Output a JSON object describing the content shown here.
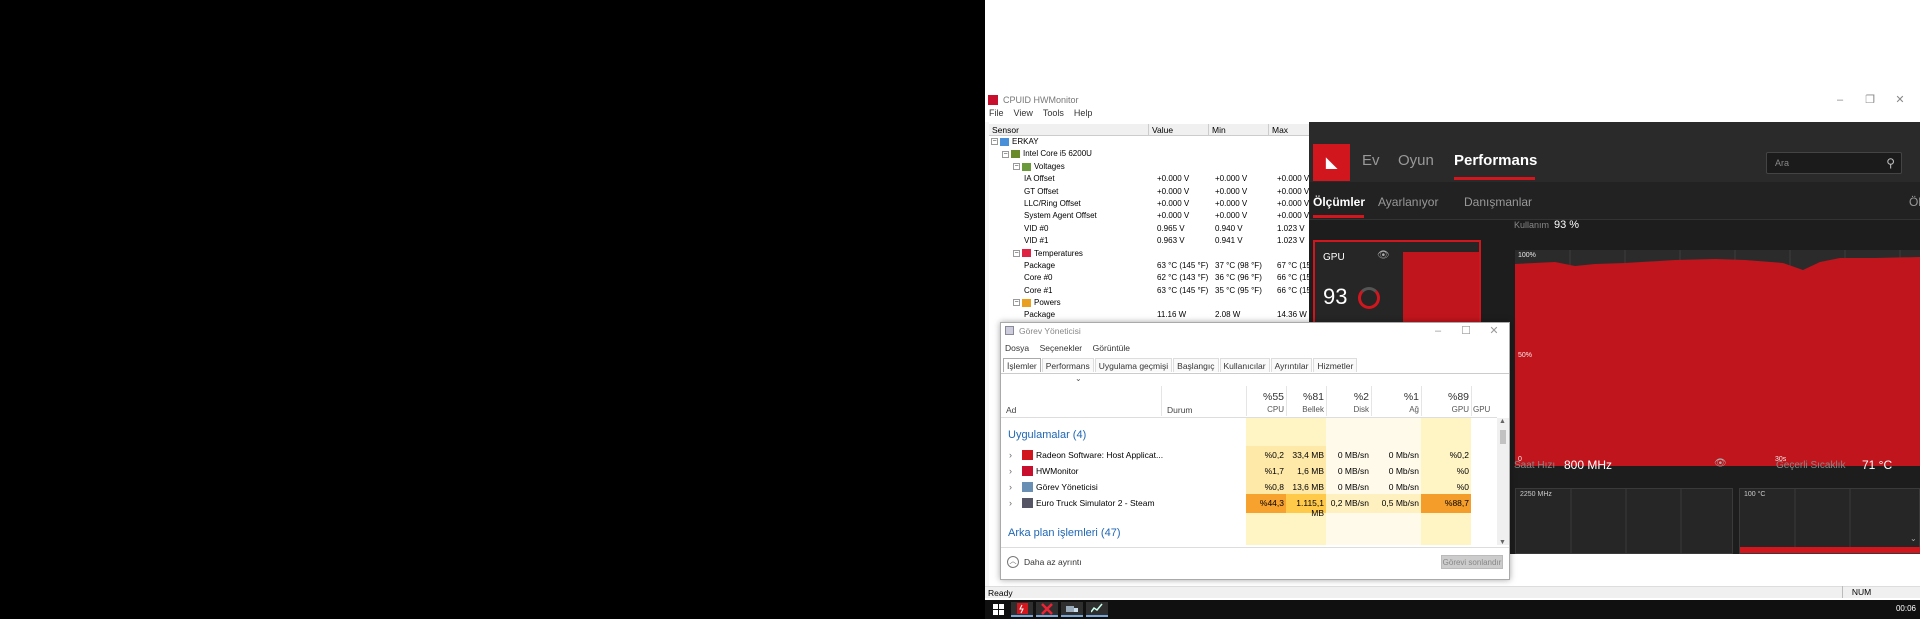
{
  "hwmonitor": {
    "title": "CPUID HWMonitor",
    "menu": [
      "File",
      "View",
      "Tools",
      "Help"
    ],
    "columns": [
      "Sensor",
      "Value",
      "Min",
      "Max"
    ],
    "rows": [
      {
        "name": "ERKAY",
        "indent": 0,
        "type": "computer",
        "value": "",
        "min": "",
        "max": ""
      },
      {
        "name": "Intel Core i5 6200U",
        "indent": 1,
        "type": "cpu",
        "value": "",
        "min": "",
        "max": ""
      },
      {
        "name": "Voltages",
        "indent": 2,
        "type": "voltages",
        "value": "",
        "min": "",
        "max": ""
      },
      {
        "name": "IA Offset",
        "indent": 3,
        "type": "leaf",
        "value": "+0.000 V",
        "min": "+0.000 V",
        "max": "+0.000 V"
      },
      {
        "name": "GT Offset",
        "indent": 3,
        "type": "leaf",
        "value": "+0.000 V",
        "min": "+0.000 V",
        "max": "+0.000 V"
      },
      {
        "name": "LLC/Ring Offset",
        "indent": 3,
        "type": "leaf",
        "value": "+0.000 V",
        "min": "+0.000 V",
        "max": "+0.000 V"
      },
      {
        "name": "System Agent Offset",
        "indent": 3,
        "type": "leaf",
        "value": "+0.000 V",
        "min": "+0.000 V",
        "max": "+0.000 V"
      },
      {
        "name": "VID #0",
        "indent": 3,
        "type": "leaf",
        "value": "0.965 V",
        "min": "0.940 V",
        "max": "1.023 V"
      },
      {
        "name": "VID #1",
        "indent": 3,
        "type": "leaf",
        "value": "0.963 V",
        "min": "0.941 V",
        "max": "1.023 V"
      },
      {
        "name": "Temperatures",
        "indent": 2,
        "type": "temps",
        "value": "",
        "min": "",
        "max": ""
      },
      {
        "name": "Package",
        "indent": 3,
        "type": "leaf",
        "value": "63 °C  (145 °F)",
        "min": "37 °C  (98 °F)",
        "max": "67 °C  (15"
      },
      {
        "name": "Core #0",
        "indent": 3,
        "type": "leaf",
        "value": "62 °C  (143 °F)",
        "min": "36 °C  (96 °F)",
        "max": "66 °C  (15"
      },
      {
        "name": "Core #1",
        "indent": 3,
        "type": "leaf",
        "value": "63 °C  (145 °F)",
        "min": "35 °C  (95 °F)",
        "max": "66 °C  (15"
      },
      {
        "name": "Powers",
        "indent": 2,
        "type": "powers",
        "value": "",
        "min": "",
        "max": ""
      },
      {
        "name": "Package",
        "indent": 3,
        "type": "leaf",
        "value": "11.16 W",
        "min": "2.08 W",
        "max": "14.36 W"
      }
    ],
    "status": "Ready",
    "num": "NUM"
  },
  "amd": {
    "nav": [
      "Ev",
      "Oyun",
      "Performans"
    ],
    "search_placeholder": "Ara",
    "subtabs": [
      "Ölçümler",
      "Ayarlanıyor",
      "Danışmanlar",
      "Ölç"
    ],
    "gpu_label": "GPU",
    "gpu_value": "93",
    "usage_label": "Kullanım",
    "usage_value": "93 %",
    "chart_labels": {
      "top": "100%",
      "mid": "50%",
      "x0": "0",
      "x1": "30s"
    },
    "clock_label": "Saat Hızı",
    "clock_value": "800 MHz",
    "temp_label": "Geçerli Sıcaklık",
    "temp_value": "71 °C",
    "mini_left_label": "2250 MHz",
    "mini_right_label": "100 °C",
    "colors": {
      "accent": "#d2161e",
      "bg": "#1d1d1d"
    }
  },
  "taskmgr": {
    "title": "Görev Yöneticisi",
    "menu": [
      "Dosya",
      "Seçenekler",
      "Görüntüle"
    ],
    "tabs": [
      "İşlemler",
      "Performans",
      "Uygulama geçmişi",
      "Başlangıç",
      "Kullanıcılar",
      "Ayrıntılar",
      "Hizmetler"
    ],
    "headers": {
      "ad": "Ad",
      "durum": "Durum",
      "cpu_pct": "%55",
      "cpu": "CPU",
      "mem_pct": "%81",
      "mem": "Bellek",
      "disk_pct": "%2",
      "disk": "Disk",
      "net_pct": "%1",
      "net": "Ağ",
      "gpu_pct": "%89",
      "gpu": "GPU",
      "gpu2": "GPU"
    },
    "group_apps": "Uygulamalar (4)",
    "group_bg": "Arka plan işlemleri (47)",
    "apps": [
      {
        "name": "Radeon Software: Host Applicat...",
        "cpu": "%0,2",
        "mem": "33,4 MB",
        "disk": "0 MB/sn",
        "net": "0 Mb/sn",
        "gpu": "%0,2",
        "icon": "radeon-icon"
      },
      {
        "name": "HWMonitor",
        "cpu": "%1,7",
        "mem": "1,6 MB",
        "disk": "0 MB/sn",
        "net": "0 Mb/sn",
        "gpu": "%0",
        "icon": "hwmonitor-icon"
      },
      {
        "name": "Görev Yöneticisi",
        "cpu": "%0,8",
        "mem": "13,6 MB",
        "disk": "0 MB/sn",
        "net": "0 Mb/sn",
        "gpu": "%0",
        "icon": "taskmgr-icon"
      },
      {
        "name": "Euro Truck Simulator 2 - Steam",
        "cpu": "%44,3",
        "mem": "1.115,1 MB",
        "disk": "0,2 MB/sn",
        "net": "0,5 Mb/sn",
        "gpu": "%88,7",
        "icon": "truck-icon"
      }
    ],
    "less_details": "Daha az ayrıntı",
    "end_task": "Görevi sonlandır"
  },
  "taskbar": {
    "clock": "00:06"
  }
}
